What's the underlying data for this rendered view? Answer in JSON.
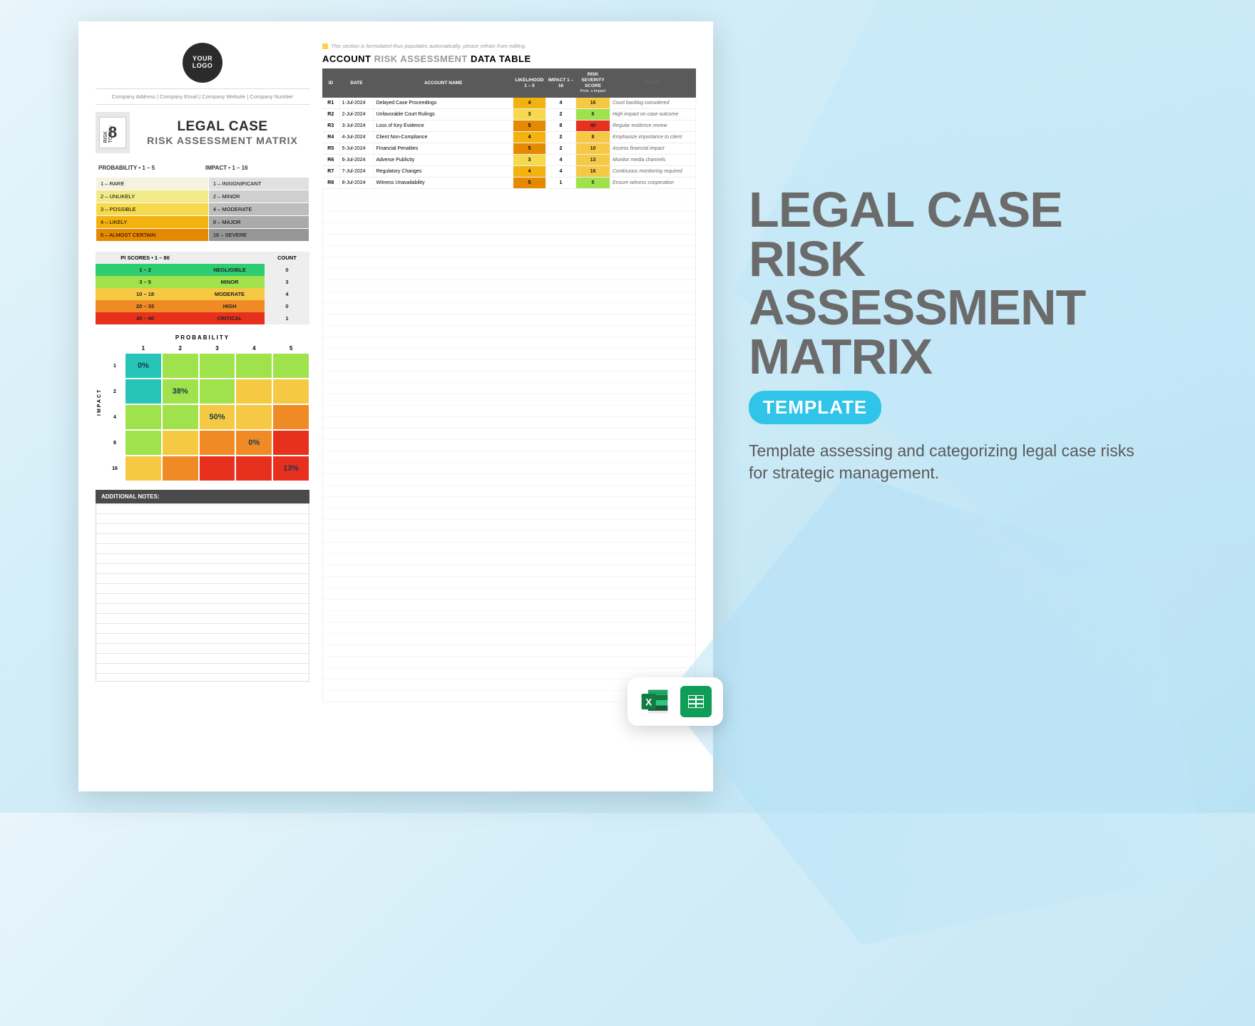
{
  "logo_text": "YOUR LOGO",
  "company_line": "Company Address  |  Company Email  |  Company Website  |  Company Number",
  "risk_total_label": "RISK TOTAL:",
  "risk_total_value": "8",
  "title_main": "LEGAL CASE",
  "title_sub": "RISK ASSESSMENT MATRIX",
  "scale": {
    "prob_header": "PROBABILITY • 1 – 5",
    "impact_header": "IMPACT • 1 – 16",
    "rows": [
      {
        "prob": "1 – RARE",
        "pc": "#f3f3e0",
        "imp": "1 – INSIGNIFICANT",
        "ic": "#e0e0e0"
      },
      {
        "prob": "2 – UNLIKELY",
        "pc": "#f2e98a",
        "imp": "2 – MINOR",
        "ic": "#cfcfcf"
      },
      {
        "prob": "3 – POSSIBLE",
        "pc": "#f6d94d",
        "imp": "4 – MODERATE",
        "ic": "#bdbdbd"
      },
      {
        "prob": "4 – LIKELY",
        "pc": "#f2b20f",
        "imp": "8 – MAJOR",
        "ic": "#aaaaaa"
      },
      {
        "prob": "5 – ALMOST CERTAIN",
        "pc": "#e58a00",
        "imp": "16 – SEVERE",
        "ic": "#969696"
      }
    ]
  },
  "pi": {
    "h1": "PI SCORES • 1 – 80",
    "h2": "",
    "h3": "COUNT",
    "rows": [
      {
        "range": "1 – 2",
        "label": "NEGLIGIBLE",
        "count": "0",
        "c": "#2ecc71"
      },
      {
        "range": "3 – 5",
        "label": "MINOR",
        "count": "3",
        "c": "#9fe24b"
      },
      {
        "range": "10 – 18",
        "label": "MODERATE",
        "count": "4",
        "c": "#f6c945"
      },
      {
        "range": "20 – 33",
        "label": "HIGH",
        "count": "0",
        "c": "#f08a24"
      },
      {
        "range": "40 – 80",
        "label": "CRITICAL",
        "count": "1",
        "c": "#e8301f"
      }
    ]
  },
  "heatmap": {
    "title": "PROBABILITY",
    "ylabel": "IMPACT",
    "cols": [
      "1",
      "2",
      "3",
      "4",
      "5"
    ],
    "rows": [
      "1",
      "2",
      "4",
      "8",
      "16"
    ],
    "cells": [
      [
        {
          "c": "#27c4b8",
          "t": "0%"
        },
        {
          "c": "#9fe24b",
          "t": ""
        },
        {
          "c": "#9fe24b",
          "t": ""
        },
        {
          "c": "#9fe24b",
          "t": ""
        },
        {
          "c": "#9fe24b",
          "t": ""
        }
      ],
      [
        {
          "c": "#27c4b8",
          "t": ""
        },
        {
          "c": "#9fe24b",
          "t": "38%"
        },
        {
          "c": "#9fe24b",
          "t": ""
        },
        {
          "c": "#f6c945",
          "t": ""
        },
        {
          "c": "#f6c945",
          "t": ""
        }
      ],
      [
        {
          "c": "#9fe24b",
          "t": ""
        },
        {
          "c": "#9fe24b",
          "t": ""
        },
        {
          "c": "#f6c945",
          "t": "50%"
        },
        {
          "c": "#f6c945",
          "t": ""
        },
        {
          "c": "#f08a24",
          "t": ""
        }
      ],
      [
        {
          "c": "#9fe24b",
          "t": ""
        },
        {
          "c": "#f6c945",
          "t": ""
        },
        {
          "c": "#f08a24",
          "t": ""
        },
        {
          "c": "#f08a24",
          "t": "0%"
        },
        {
          "c": "#e8301f",
          "t": ""
        }
      ],
      [
        {
          "c": "#f6c945",
          "t": ""
        },
        {
          "c": "#f08a24",
          "t": ""
        },
        {
          "c": "#e8301f",
          "t": ""
        },
        {
          "c": "#e8301f",
          "t": ""
        },
        {
          "c": "#e8301f",
          "t": "13%"
        }
      ]
    ]
  },
  "notes_header": "ADDITIONAL NOTES:",
  "auto_note": "This section is formulated thus populates automatically, please refrain from editing.",
  "data_title_a": "ACCOUNT ",
  "data_title_b": "RISK ASSESSMENT ",
  "data_title_c": "DATA TABLE",
  "columns": {
    "id": "ID",
    "date": "DATE",
    "name": "ACCOUNT NAME",
    "like": "LIKELIHOOD 1 – 5",
    "impact": "IMPACT 1 – 16",
    "score": "RISK SEVERITY SCORE",
    "score2": "Prob. x Impact",
    "notes": "NOTES"
  },
  "rows": [
    {
      "id": "R1",
      "date": "1-Jul-2024",
      "name": "Delayed Case Proceedings",
      "like": "4",
      "lc": "#f2b20f",
      "imp": "4",
      "sc": "16",
      "scc": "#f6c945",
      "notes": "Court backlog considered"
    },
    {
      "id": "R2",
      "date": "2-Jul-2024",
      "name": "Unfavorable Court Rulings",
      "like": "3",
      "lc": "#f6d94d",
      "imp": "2",
      "sc": "6",
      "scc": "#9fe24b",
      "notes": "High impact on case outcome"
    },
    {
      "id": "R3",
      "date": "3-Jul-2024",
      "name": "Loss of Key Evidence",
      "like": "5",
      "lc": "#e58a00",
      "imp": "8",
      "sc": "40",
      "scc": "#e8301f",
      "notes": "Regular evidence review"
    },
    {
      "id": "R4",
      "date": "4-Jul-2024",
      "name": "Client Non-Compliance",
      "like": "4",
      "lc": "#f2b20f",
      "imp": "2",
      "sc": "8",
      "scc": "#f6c945",
      "notes": "Emphasize importance to client"
    },
    {
      "id": "R5",
      "date": "5-Jul-2024",
      "name": "Financial Penalties",
      "like": "5",
      "lc": "#e58a00",
      "imp": "2",
      "sc": "10",
      "scc": "#f6c945",
      "notes": "Assess financial impact"
    },
    {
      "id": "R6",
      "date": "6-Jul-2024",
      "name": "Adverse Publicity",
      "like": "3",
      "lc": "#f6d94d",
      "imp": "4",
      "sc": "13",
      "scc": "#f6c945",
      "notes": "Monitor media channels"
    },
    {
      "id": "R7",
      "date": "7-Jul-2024",
      "name": "Regulatory Changes",
      "like": "4",
      "lc": "#f2b20f",
      "imp": "4",
      "sc": "16",
      "scc": "#f6c945",
      "notes": "Continuous monitoring required"
    },
    {
      "id": "R8",
      "date": "8-Jul-2024",
      "name": "Witness Unavailability",
      "like": "5",
      "lc": "#e58a00",
      "imp": "1",
      "sc": "5",
      "scc": "#9fe24b",
      "notes": "Ensure witness cooperation"
    }
  ],
  "promo": {
    "title": "LEGAL CASE RISK ASSESSMENT MATRIX",
    "badge": "TEMPLATE",
    "desc": "Template assessing and categorizing legal case risks for strategic management."
  }
}
